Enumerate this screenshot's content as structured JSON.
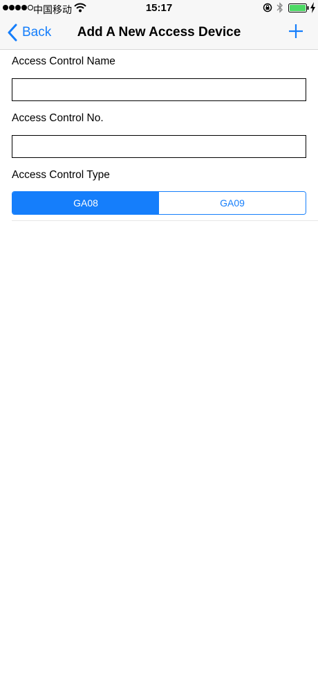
{
  "status_bar": {
    "carrier": "中国移动",
    "time": "15:17",
    "icons": [
      "signal-dots",
      "wifi-icon",
      "lock-rotation-icon",
      "bluetooth-icon",
      "battery-icon",
      "charging-icon"
    ]
  },
  "nav": {
    "back_label": "Back",
    "title": "Add A New Access Device",
    "add_icon": "plus-icon"
  },
  "form": {
    "name_label": "Access Control Name",
    "name_value": "",
    "number_label": "Access Control No.",
    "number_value": "",
    "type_label": "Access Control Type",
    "type_options": [
      "GA08",
      "GA09"
    ],
    "type_selected": "GA08"
  },
  "colors": {
    "accent": "#157efb",
    "battery": "#4cd964"
  }
}
